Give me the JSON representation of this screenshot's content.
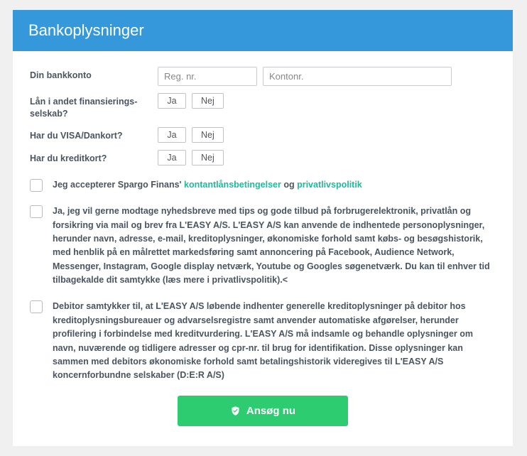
{
  "header": {
    "title": "Bankoplysninger"
  },
  "fields": {
    "bank_label": "Din bankkonto",
    "reg_placeholder": "Reg. nr.",
    "konto_placeholder": "Kontonr.",
    "loan_label": "Lån i andet finansierings-selskab?",
    "visa_label": "Har du VISA/Dankort?",
    "kredit_label": "Har du kreditkort?",
    "yes": "Ja",
    "no": "Nej"
  },
  "checks": {
    "c1_pre": "Jeg accepterer Spargo Finans' ",
    "c1_link1": "kontantlånsbetingelser",
    "c1_mid": " og ",
    "c1_link2": "privatlivspolitik",
    "c2": "Ja, jeg vil gerne modtage nyhedsbreve med tips og gode tilbud på forbrugerelektronik, privatlån og forsikring via mail og brev fra L'EASY A/S. L'EASY A/S kan anvende de indhentede personoplysninger, herunder navn, adresse, e-mail, kreditoplysninger, økonomiske forhold samt købs- og besøgshistorik, med henblik på en målrettet markedsføring samt annoncering på Facebook, Audience Network, Messenger, Instagram, Google display netværk, Youtube og Googles søgenetværk. Du kan til enhver tid tilbagekalde dit samtykke (læs mere i privatlivspolitik).<",
    "c3": "Debitor samtykker til, at L'EASY A/S løbende indhenter generelle kreditoplysninger på debitor hos kreditoplysningsbureauer og advarselsregistre samt anvender automatiske afgørelser, herunder profilering i forbindelse med kreditvurdering. L'EASY A/S må indsamle og behandle oplysninger om navn, nuværende og tidligere adresser og cpr-nr. til brug for identifikation. Disse oplysninger kan sammen med debitors økonomiske forhold samt betalingshistorik videregives til L'EASY A/S koncernforbundne selskaber (D:E:R A/S)"
  },
  "submit": {
    "label": "Ansøg nu"
  }
}
